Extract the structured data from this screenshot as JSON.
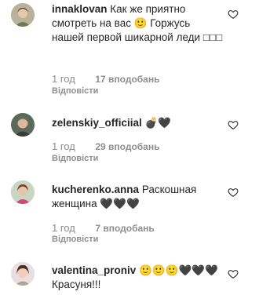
{
  "comments": [
    {
      "username": "innaklovan",
      "text": "Как же приятно смотреть на вас 🙂 Горжусь нашей первой шикарной леди □□□",
      "time": "1 год",
      "likes": "17 вподобань",
      "reply": "Відповісти"
    },
    {
      "username": "zelenskiy_officiial",
      "text": "💣🖤",
      "time": "1 год",
      "likes": "29 вподобань",
      "reply": "Відповісти"
    },
    {
      "username": "kucherenko.anna",
      "text": "Раскошная женщина 🖤🖤🖤",
      "time": "1 год",
      "likes": "7 вподобань",
      "reply": "Відповісти"
    },
    {
      "username": "valentina_proniv",
      "text": "🙂🙂🙂🖤🖤🖤 Красуня!!!",
      "time": "",
      "likes": "",
      "reply": ""
    }
  ],
  "colors": {
    "text": "#262626",
    "muted": "#8e8e8e"
  },
  "icons": {
    "like": "heart-outline-icon"
  }
}
